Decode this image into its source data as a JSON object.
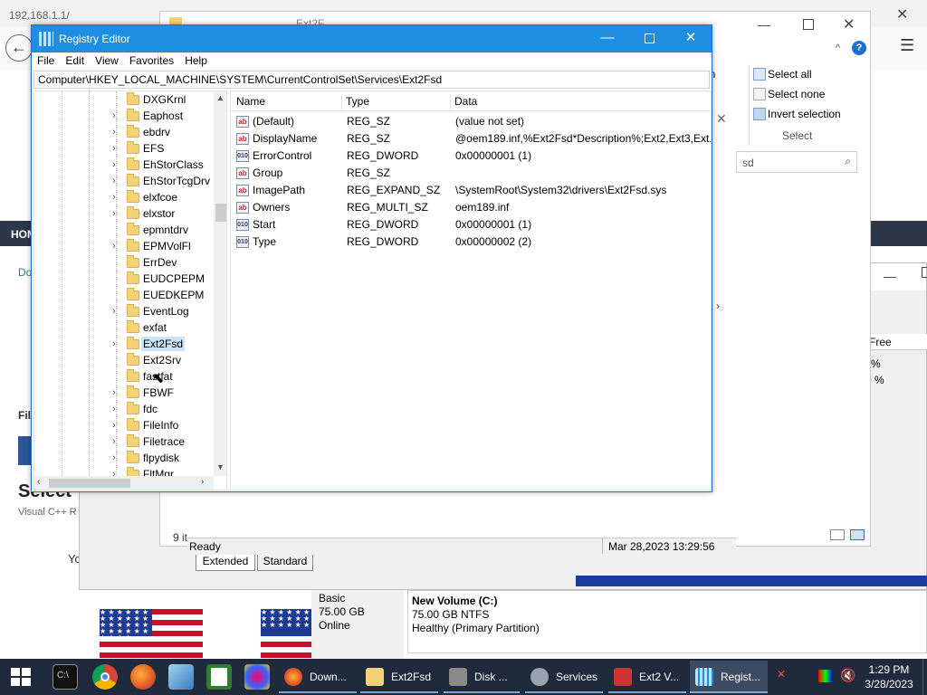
{
  "browser": {
    "url": "192.168.1.1/",
    "hom": "HOM",
    "do": "Do",
    "file": "File",
    "select": "Select",
    "visual": "Visual C++ R",
    "yo": "Yo",
    "close_x": "✕"
  },
  "explorer": {
    "title_fragment": "Ext2F...",
    "ribbon": {
      "select_all": "Select all",
      "select_none": "Select none",
      "invert_selection": "Invert selection",
      "group": "Select",
      "open_label": "en"
    },
    "search_placeholder": "sd",
    "items_count": "9 it",
    "status": "Ready",
    "datetime": "Mar 28,2023 13:29:56",
    "tabs": [
      "Extended",
      "Standard"
    ],
    "free_header": "Free",
    "free_v1": "%",
    "free_v2": "0 %"
  },
  "disk": {
    "type": "Basic",
    "size": "75.00 GB",
    "status": "Online",
    "vol_name": "New Volume  (C:)",
    "vol_size": "75.00 GB NTFS",
    "vol_health": "Healthy (Primary Partition)"
  },
  "registry": {
    "title": "Registry Editor",
    "menu": [
      "File",
      "Edit",
      "View",
      "Favorites",
      "Help"
    ],
    "address": "Computer\\HKEY_LOCAL_MACHINE\\SYSTEM\\CurrentControlSet\\Services\\Ext2Fsd",
    "tree": [
      "DXGKrnl",
      "Eaphost",
      "ebdrv",
      "EFS",
      "EhStorClass",
      "EhStorTcgDrv",
      "elxfcoe",
      "elxstor",
      "epmntdrv",
      "EPMVolFl",
      "ErrDev",
      "EUDCPEPM",
      "EUEDKEPM",
      "EventLog",
      "exfat",
      "Ext2Fsd",
      "Ext2Srv",
      "fastfat",
      "FBWF",
      "fdc",
      "FileInfo",
      "Filetrace",
      "flpydisk",
      "FltMgr"
    ],
    "selected_key": "Ext2Fsd",
    "columns": {
      "name": "Name",
      "type": "Type",
      "data": "Data"
    },
    "values": [
      {
        "name": "(Default)",
        "type": "REG_SZ",
        "data": "(value not set)",
        "icon": "string-value-icon"
      },
      {
        "name": "DisplayName",
        "type": "REG_SZ",
        "data": "@oem189.inf,%Ext2Fsd*Description%;Ext2,Ext3,Ext...",
        "icon": "string-value-icon"
      },
      {
        "name": "ErrorControl",
        "type": "REG_DWORD",
        "data": "0x00000001 (1)",
        "icon": "binary-value-icon"
      },
      {
        "name": "Group",
        "type": "REG_SZ",
        "data": "",
        "icon": "string-value-icon"
      },
      {
        "name": "ImagePath",
        "type": "REG_EXPAND_SZ",
        "data": "\\SystemRoot\\System32\\drivers\\Ext2Fsd.sys",
        "icon": "string-value-icon"
      },
      {
        "name": "Owners",
        "type": "REG_MULTI_SZ",
        "data": "oem189.inf",
        "icon": "string-value-icon"
      },
      {
        "name": "Start",
        "type": "REG_DWORD",
        "data": "0x00000001 (1)",
        "icon": "binary-value-icon"
      },
      {
        "name": "Type",
        "type": "REG_DWORD",
        "data": "0x00000002 (2)",
        "icon": "binary-value-icon"
      }
    ]
  },
  "taskbar": {
    "tasks": [
      {
        "label": "Down...",
        "name": "firefox-task"
      },
      {
        "label": "Ext2Fsd",
        "name": "explorer-task"
      },
      {
        "label": "Disk ...",
        "name": "disk-management-task"
      },
      {
        "label": "Services",
        "name": "services-task"
      },
      {
        "label": "Ext2 V...",
        "name": "ext2-volume-manager-task"
      },
      {
        "label": "Regist...",
        "name": "registry-editor-task"
      }
    ],
    "time": "1:29 PM",
    "date": "3/28/2023"
  }
}
